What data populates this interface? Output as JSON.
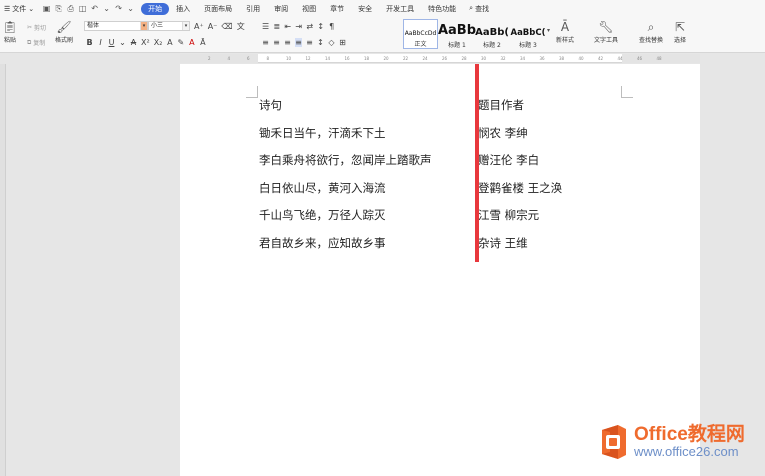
{
  "menubar": {
    "file_label": "文件",
    "tabs": [
      "开始",
      "插入",
      "页面布局",
      "引用",
      "审阅",
      "视图",
      "章节",
      "安全",
      "开发工具",
      "特色功能"
    ],
    "active_tab": 0,
    "search_label": "查找"
  },
  "ribbon": {
    "paste_label": "粘贴",
    "cut_label": "剪切",
    "copy_label": "复制",
    "format_painter_label": "格式刷",
    "font_name": "楷体",
    "font_size": "小三",
    "styles": [
      {
        "preview": "AaBbCcDd",
        "name": "正文"
      },
      {
        "preview": "AaBb",
        "name": "标题 1"
      },
      {
        "preview": "AaBb(",
        "name": "标题 2"
      },
      {
        "preview": "AaBbC(",
        "name": "标题 3"
      }
    ],
    "new_style_label": "新样式",
    "text_tools_label": "文字工具",
    "find_replace_label": "查找替换",
    "select_label": "选择"
  },
  "ruler": {
    "ticks": [
      "2",
      "4",
      "6",
      "8",
      "10",
      "12",
      "14",
      "16",
      "18",
      "20",
      "22",
      "24",
      "26",
      "28",
      "30",
      "32",
      "34",
      "36",
      "38",
      "40",
      "42",
      "44",
      "46",
      "48"
    ]
  },
  "document": {
    "column1": [
      "诗句",
      "锄禾日当午，汗滴禾下土",
      "李白乘舟将欲行，忽闻岸上踏歌声",
      "白日依山尽，黄河入海流",
      "千山鸟飞绝，万径人踪灭",
      "君自故乡来，应知故乡事"
    ],
    "column2": [
      "题目作者",
      "悯农 李绅",
      "赠汪伦 李白",
      "登鹳雀楼 王之涣",
      "江雪 柳宗元",
      "杂诗 王维"
    ]
  },
  "watermark": {
    "name": "Office教程网",
    "url": "www.office26.com"
  },
  "colors": {
    "accent": "#3f6dd8",
    "highlight_bar": "#e8383d",
    "watermark_orange": "#ef6b2e"
  }
}
